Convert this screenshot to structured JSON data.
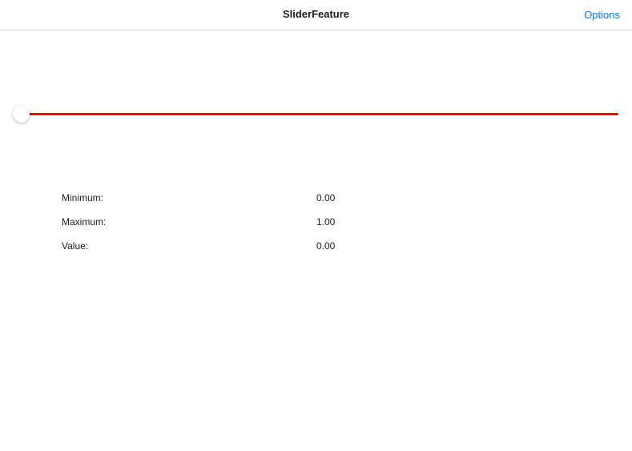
{
  "navbar": {
    "title": "SliderFeature",
    "options_label": "Options"
  },
  "slider": {
    "min": 0,
    "max": 1,
    "value": 0,
    "track_color": "#ff0000",
    "thumb_color": "#ffffff"
  },
  "info": {
    "rows": [
      {
        "label": "Minimum:",
        "value": "0.00"
      },
      {
        "label": "Maximum:",
        "value": "1.00"
      },
      {
        "label": "Value:",
        "value": "0.00"
      }
    ]
  },
  "colors": {
    "accent": "#0a7aff",
    "divider": "#d1d1d6"
  }
}
